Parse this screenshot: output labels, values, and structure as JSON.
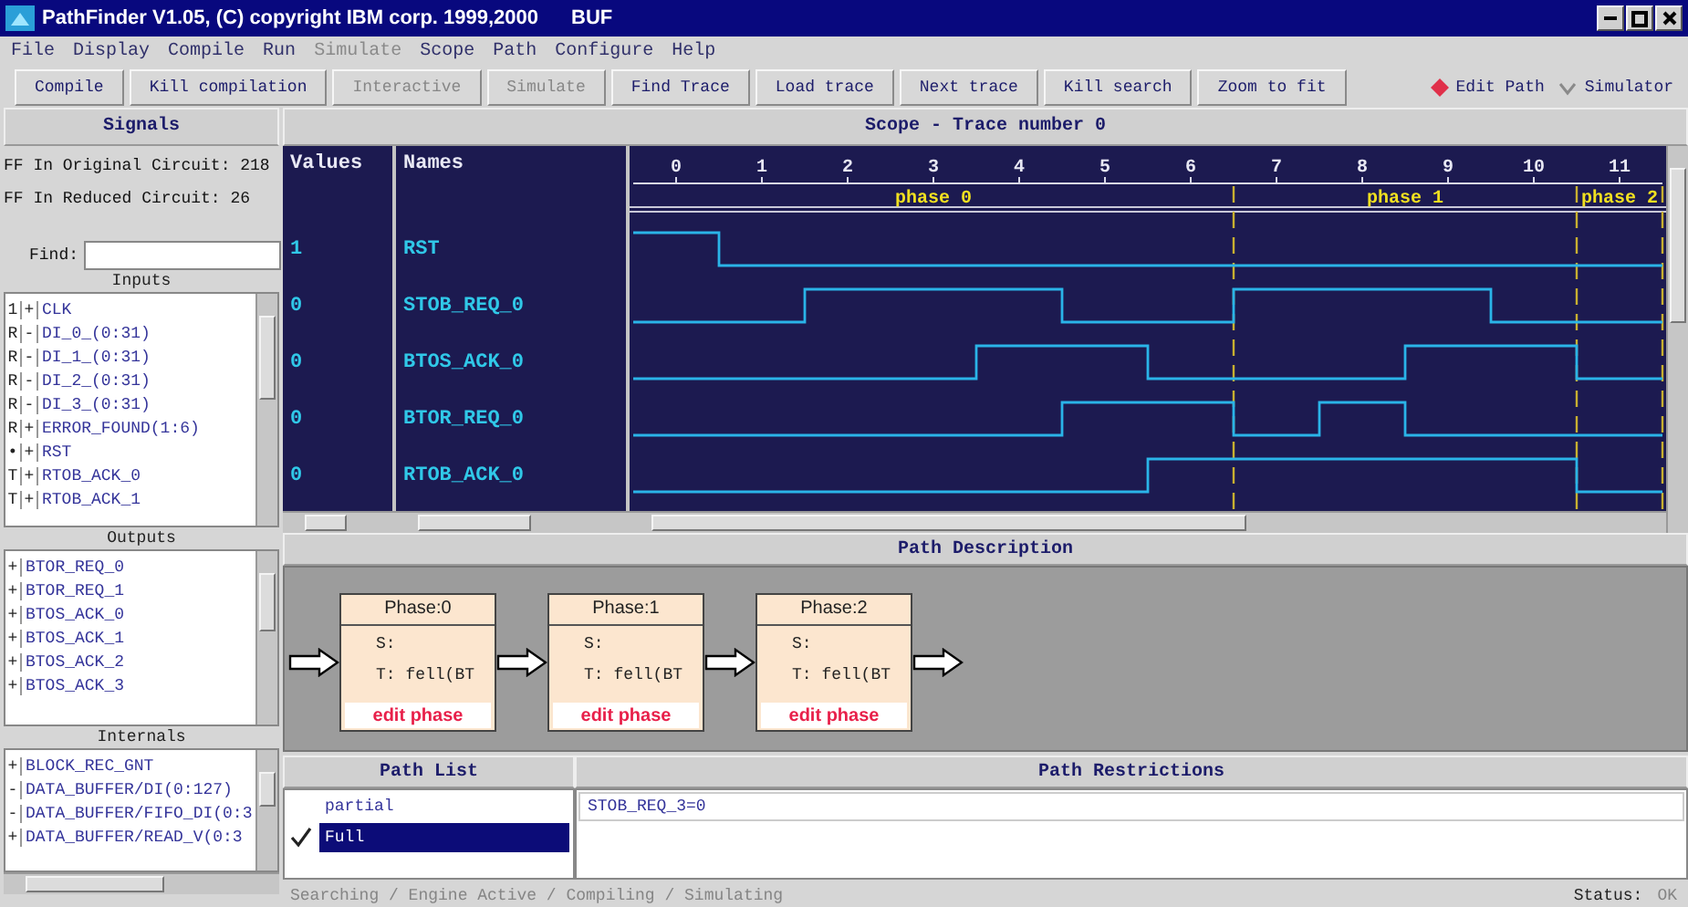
{
  "window": {
    "title": "PathFinder V1.05, (C) copyright IBM corp. 1999,2000",
    "subtitle": "BUF"
  },
  "menu": [
    {
      "label": "File",
      "disabled": false
    },
    {
      "label": "Display",
      "disabled": false
    },
    {
      "label": "Compile",
      "disabled": false
    },
    {
      "label": "Run",
      "disabled": false
    },
    {
      "label": "Simulate",
      "disabled": true
    },
    {
      "label": "Scope",
      "disabled": false
    },
    {
      "label": "Path",
      "disabled": false
    },
    {
      "label": "Configure",
      "disabled": false
    },
    {
      "label": "Help",
      "disabled": false
    }
  ],
  "toolbar": {
    "buttons": [
      {
        "label": "Compile",
        "disabled": false
      },
      {
        "label": "Kill compilation",
        "disabled": false
      },
      {
        "label": "Interactive",
        "disabled": true
      },
      {
        "label": "Simulate",
        "disabled": true
      },
      {
        "label": "Find Trace",
        "disabled": false
      },
      {
        "label": "Load trace",
        "disabled": false
      },
      {
        "label": "Next trace",
        "disabled": false
      },
      {
        "label": "Kill search",
        "disabled": false
      },
      {
        "label": "Zoom to fit",
        "disabled": false
      }
    ],
    "modes": [
      {
        "label": "Edit Path",
        "selected": true
      },
      {
        "label": "Simulator",
        "selected": false
      }
    ]
  },
  "signals": {
    "title": "Signals",
    "stats": [
      "FF In Original Circuit: 218",
      "FF In Reduced Circuit: 26"
    ],
    "find_label": "Find:",
    "sections": [
      {
        "title": "Inputs",
        "items": [
          {
            "flag": "1",
            "sign": "+",
            "name": "CLK"
          },
          {
            "flag": "R",
            "sign": "-",
            "name": "DI_0_(0:31)"
          },
          {
            "flag": "R",
            "sign": "-",
            "name": "DI_1_(0:31)"
          },
          {
            "flag": "R",
            "sign": "-",
            "name": "DI_2_(0:31)"
          },
          {
            "flag": "R",
            "sign": "-",
            "name": "DI_3_(0:31)"
          },
          {
            "flag": "R",
            "sign": "+",
            "name": "ERROR_FOUND(1:6)"
          },
          {
            "flag": "•",
            "sign": "+",
            "name": "RST"
          },
          {
            "flag": "T",
            "sign": "+",
            "name": "RTOB_ACK_0"
          },
          {
            "flag": "T",
            "sign": "+",
            "name": "RTOB_ACK_1"
          }
        ]
      },
      {
        "title": "Outputs",
        "items": [
          {
            "sign": "+",
            "name": "BTOR_REQ_0"
          },
          {
            "sign": "+",
            "name": "BTOR_REQ_1"
          },
          {
            "sign": "+",
            "name": "BTOS_ACK_0"
          },
          {
            "sign": "+",
            "name": "BTOS_ACK_1"
          },
          {
            "sign": "+",
            "name": "BTOS_ACK_2"
          },
          {
            "sign": "+",
            "name": "BTOS_ACK_3"
          }
        ]
      },
      {
        "title": "Internals",
        "items": [
          {
            "sign": "+",
            "name": "BLOCK_REC_GNT"
          },
          {
            "sign": "-",
            "name": "DATA_BUFFER/DI(0:127)"
          },
          {
            "sign": "-",
            "name": "DATA_BUFFER/FIFO_DI(0:3"
          },
          {
            "sign": "+",
            "name": "DATA_BUFFER/READ_V(0:3"
          }
        ]
      }
    ]
  },
  "scope": {
    "title": "Scope - Trace number 0",
    "columns": [
      "Values",
      "Names"
    ],
    "values": [
      "1",
      "0",
      "0",
      "0",
      "0"
    ],
    "names": [
      "RST",
      "STOB_REQ_0",
      "BTOS_ACK_0",
      "BTOR_REQ_0",
      "RTOB_ACK_0"
    ],
    "time_ticks": [
      "0",
      "1",
      "2",
      "3",
      "4",
      "5",
      "6",
      "7",
      "8",
      "9",
      "10",
      "11"
    ],
    "phases": [
      "phase 0",
      "phase 1",
      "phase 2"
    ]
  },
  "path_description": {
    "title": "Path Description",
    "phases": [
      {
        "title": "Phase:0",
        "source": "S:",
        "target": "T: fell(BT",
        "action": "edit phase"
      },
      {
        "title": "Phase:1",
        "source": "S:",
        "target": "T: fell(BT",
        "action": "edit phase"
      },
      {
        "title": "Phase:2",
        "source": "S:",
        "target": "T: fell(BT",
        "action": "edit phase"
      }
    ]
  },
  "path_list": {
    "title": "Path List",
    "items": [
      {
        "label": "partial",
        "selected": false,
        "checked": false
      },
      {
        "label": "Full",
        "selected": true,
        "checked": true
      }
    ]
  },
  "path_restrictions": {
    "title": "Path Restrictions",
    "items": [
      "STOB_REQ_3=0"
    ]
  },
  "status_bar": {
    "activity": "Searching / Engine Active / Compiling / Simulating",
    "label": "Status:",
    "value": "OK"
  }
}
